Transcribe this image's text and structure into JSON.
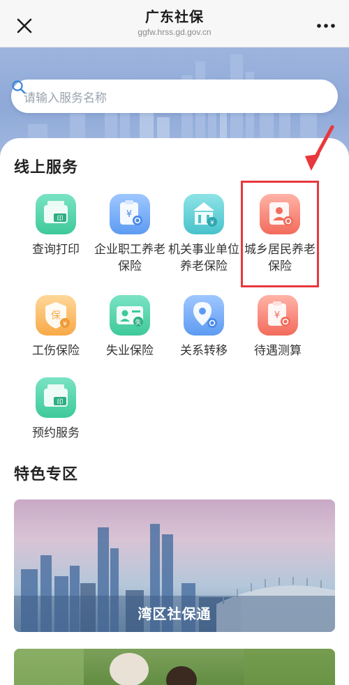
{
  "header": {
    "title": "广东社保",
    "subtitle": "ggfw.hrss.gd.gov.cn"
  },
  "search": {
    "placeholder": "请输入服务名称"
  },
  "online_services": {
    "title": "线上服务",
    "items": [
      {
        "label": "查询打印",
        "icon": "printer-icon"
      },
      {
        "label": "企业职工养老保险",
        "icon": "clipboard-yuan-icon"
      },
      {
        "label": "机关事业单位养老保险",
        "icon": "government-building-icon"
      },
      {
        "label": "城乡居民养老保险",
        "icon": "person-card-search-icon"
      },
      {
        "label": "工伤保险",
        "icon": "shield-bao-icon"
      },
      {
        "label": "失业保险",
        "icon": "id-card-shi-icon"
      },
      {
        "label": "关系转移",
        "icon": "location-pin-icon"
      },
      {
        "label": "待遇测算",
        "icon": "clipboard-yuan-icon"
      },
      {
        "label": "预约服务",
        "icon": "printer-icon"
      }
    ]
  },
  "featured": {
    "title": "特色专区",
    "banners": [
      {
        "caption": "湾区社保通"
      }
    ]
  },
  "colors": {
    "highlight": "#e8383d",
    "green": "#3ec99a",
    "blue": "#5d9bf2",
    "teal": "#48c2cb",
    "red": "#f26b5c",
    "orange": "#f7a947"
  }
}
